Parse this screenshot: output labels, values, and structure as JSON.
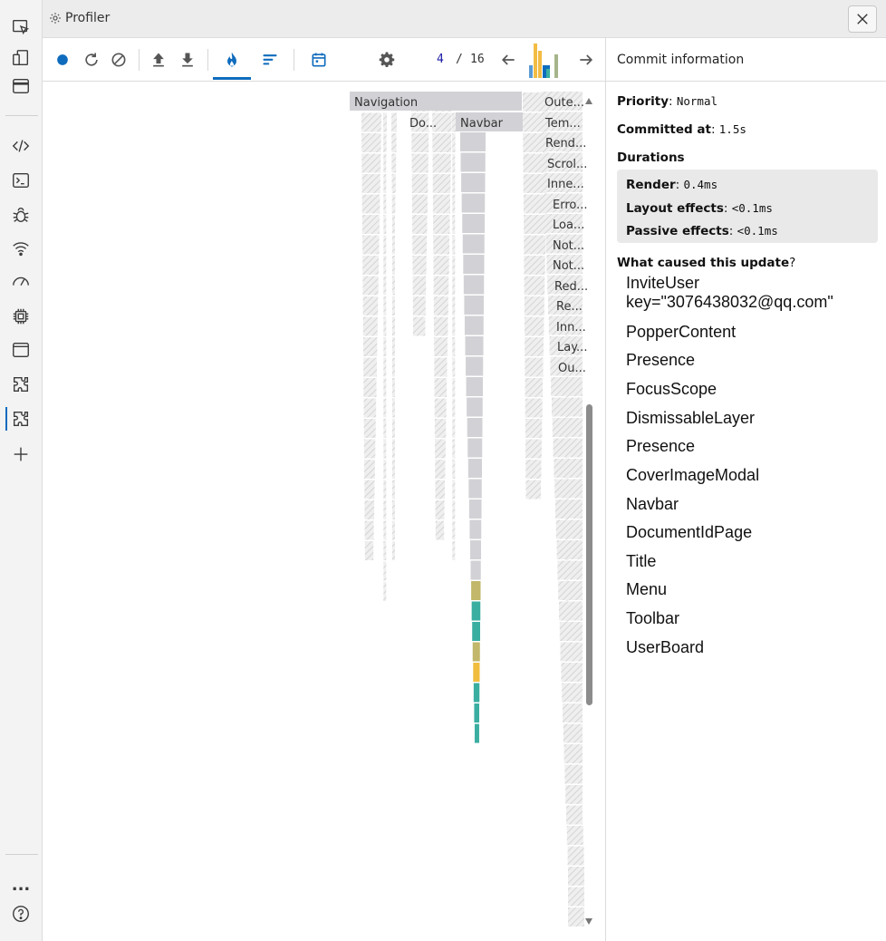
{
  "window": {
    "title": "Profiler",
    "close_icon": "close-icon"
  },
  "activity_bar": {
    "icons": [
      "inspect-icon",
      "device-emulation-icon",
      "browser-window-icon",
      "elements-icon",
      "console-icon",
      "debug-icon",
      "network-icon",
      "performance-icon",
      "memory-icon",
      "application-icon",
      "react-components-icon",
      "react-profiler-icon",
      "add-tool-icon",
      "more-tools-icon",
      "help-icon"
    ],
    "more_label": "...",
    "help_label": "?"
  },
  "toolbar": {
    "record_color": "#0f6cbd",
    "active_tab": "flamegraph",
    "commit_index": "4",
    "commit_separator": "/",
    "commit_total": "16",
    "commit_bar_colors": [
      "#5b9bd5",
      "#f3bc44",
      "#f3bc44",
      "#0f6cbd",
      "#a7b58a"
    ]
  },
  "flamegraph": {
    "colors": {
      "unchanged": "#d2d2d6",
      "hatched": "#e2e2e2",
      "olive": "#c2b76a",
      "teal": "#3aaea1",
      "yellow": "#f1bd3f"
    },
    "labels": {
      "navigation": "Navigation",
      "do": "Do...",
      "navbar": "Navbar",
      "outer": "Oute...",
      "tem": "Tem...",
      "rend": "Rend...",
      "scrol": "Scrol...",
      "inne": "Inne...",
      "erro": "Erro...",
      "loa": "Loa...",
      "not1": "Not...",
      "not2": "Not...",
      "red": "Red...",
      "re": "Re...",
      "inn": "Inn...",
      "lay": "Lay...",
      "ou": "Ou..."
    }
  },
  "commit_info": {
    "header": "Commit information",
    "priority_label": "Priority",
    "priority_value": "Normal",
    "committed_label": "Committed at",
    "committed_value": "1.5s",
    "durations_label": "Durations",
    "render_label": "Render",
    "render_value": "0.4ms",
    "layout_label": "Layout effects",
    "layout_value": "<0.1ms",
    "passive_label": "Passive effects",
    "passive_value": "<0.1ms",
    "cause_label": "What caused this update",
    "cause_q": "?",
    "causes": [
      "InviteUser\nkey=\"3076438032@qq.com\"",
      "PopperContent",
      "Presence",
      "FocusScope",
      "DismissableLayer",
      "Presence",
      "CoverImageModal",
      "Navbar",
      "DocumentIdPage",
      "Title",
      "Menu",
      "Toolbar",
      "UserBoard"
    ]
  }
}
